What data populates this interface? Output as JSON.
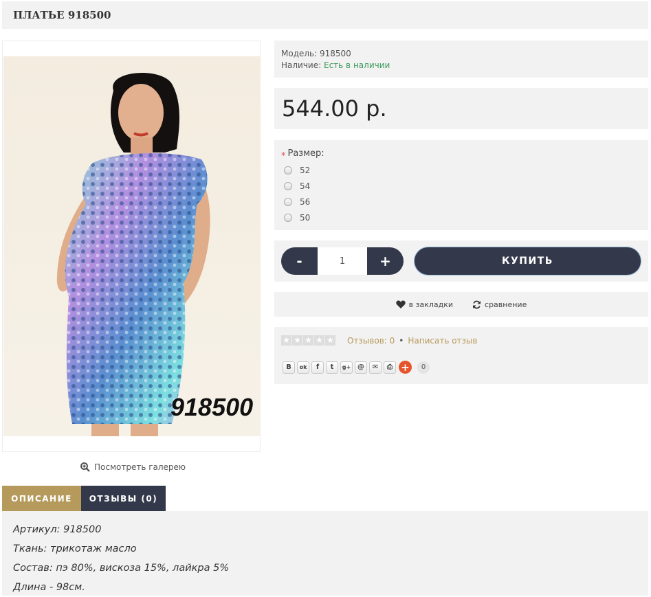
{
  "product": {
    "title": "ПЛАТЬЕ 918500",
    "image_alt": "Платье 918500",
    "image_code": "918500",
    "gallery_link": "Посмотреть галерею"
  },
  "info": {
    "model_label": "Модель:",
    "model_value": "918500",
    "availability_label": "Наличие:",
    "availability_value": "Есть в наличии"
  },
  "price": "544.00 р.",
  "options": {
    "size_label": "Размер:",
    "sizes": [
      "52",
      "54",
      "56",
      "50"
    ]
  },
  "cart": {
    "minus": "-",
    "quantity": "1",
    "plus": "+",
    "buy_label": "КУПИТЬ"
  },
  "actions": {
    "wishlist": "в закладки",
    "compare": "сравнение"
  },
  "reviews": {
    "count_text": "Отзывов: 0",
    "separator": "•",
    "write_text": "Написать отзыв",
    "rating": 0
  },
  "share": {
    "buttons": [
      {
        "icon": "vk-icon",
        "glyph": "B"
      },
      {
        "icon": "odnoklassniki-icon",
        "glyph": "ok"
      },
      {
        "icon": "facebook-icon",
        "glyph": "f"
      },
      {
        "icon": "twitter-icon",
        "glyph": "t"
      },
      {
        "icon": "google-plus-icon",
        "glyph": "g+"
      },
      {
        "icon": "mail-ru-icon",
        "glyph": "@"
      },
      {
        "icon": "email-icon",
        "glyph": "✉"
      },
      {
        "icon": "print-icon",
        "glyph": "⎙"
      }
    ],
    "plus": "+",
    "count": "0"
  },
  "tabs": {
    "description": "ОПИСАНИЕ",
    "reviews": "ОТЗЫВЫ (0)"
  },
  "description": {
    "lines": [
      "Артикул: 918500",
      "Ткань: трикотаж масло",
      "Состав: пэ 80%, вискоза 15%, лайкра 5%",
      "Длина  - 98см."
    ]
  },
  "colors": {
    "panel_bg": "#f2f2f2",
    "dark_button": "#33394a",
    "accent_gold": "#b59a5c",
    "available_green": "#3a9b5a",
    "share_plus": "#e6542b"
  }
}
